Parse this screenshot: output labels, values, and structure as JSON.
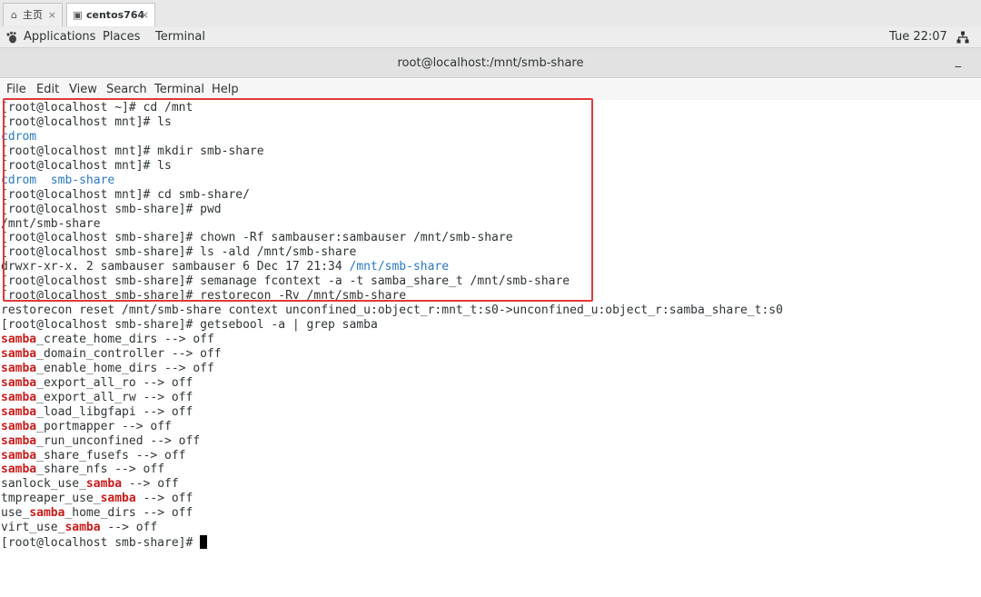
{
  "host_tabs": [
    {
      "label": "主页",
      "icon": "home-icon",
      "active": false
    },
    {
      "label": "centos764",
      "icon": "vm-icon",
      "active": true
    }
  ],
  "panel": {
    "applications": "Applications",
    "places": "Places",
    "terminal": "Terminal",
    "clock": "Tue 22:07"
  },
  "window": {
    "title": "root@localhost:/mnt/smb-share",
    "minimize_label": "_"
  },
  "menu": [
    "File",
    "Edit",
    "View",
    "Search",
    "Terminal",
    "Help"
  ],
  "colors": {
    "directory": "#2a78c4",
    "grep_match": "#cc1a1a",
    "highlight_box": "#e03a3a"
  },
  "terminal_lines": [
    [
      {
        "t": "[root@localhost ~]# cd /mnt"
      }
    ],
    [
      {
        "t": "[root@localhost mnt]# ls"
      }
    ],
    [
      {
        "t": "cdrom",
        "c": "dir"
      }
    ],
    [
      {
        "t": "[root@localhost mnt]# mkdir smb-share"
      }
    ],
    [
      {
        "t": "[root@localhost mnt]# ls"
      }
    ],
    [
      {
        "t": "cdrom",
        "c": "dir"
      },
      {
        "t": "  "
      },
      {
        "t": "smb-share",
        "c": "dir"
      }
    ],
    [
      {
        "t": "[root@localhost mnt]# cd smb-share/"
      }
    ],
    [
      {
        "t": "[root@localhost smb-share]# pwd"
      }
    ],
    [
      {
        "t": "/mnt/smb-share"
      }
    ],
    [
      {
        "t": "[root@localhost smb-share]# chown -Rf sambauser:sambauser /mnt/smb-share"
      }
    ],
    [
      {
        "t": "[root@localhost smb-share]# ls -ald /mnt/smb-share"
      }
    ],
    [
      {
        "t": "drwxr-xr-x. 2 sambauser sambauser 6 Dec 17 21:34 "
      },
      {
        "t": "/mnt/smb-share",
        "c": "dir"
      }
    ],
    [
      {
        "t": "[root@localhost smb-share]# semanage fcontext -a -t samba_share_t /mnt/smb-share"
      }
    ],
    [
      {
        "t": "[root@localhost smb-share]# restorecon -Rv /mnt/smb-share"
      }
    ],
    [
      {
        "t": "restorecon reset /mnt/smb-share context unconfined_u:object_r:mnt_t:s0->unconfined_u:object_r:samba_share_t:s0"
      }
    ],
    [
      {
        "t": "[root@localhost smb-share]# getsebool -a | grep samba"
      }
    ],
    [
      {
        "t": "samba",
        "c": "hl"
      },
      {
        "t": "_create_home_dirs --> off"
      }
    ],
    [
      {
        "t": "samba",
        "c": "hl"
      },
      {
        "t": "_domain_controller --> off"
      }
    ],
    [
      {
        "t": "samba",
        "c": "hl"
      },
      {
        "t": "_enable_home_dirs --> off"
      }
    ],
    [
      {
        "t": "samba",
        "c": "hl"
      },
      {
        "t": "_export_all_ro --> off"
      }
    ],
    [
      {
        "t": "samba",
        "c": "hl"
      },
      {
        "t": "_export_all_rw --> off"
      }
    ],
    [
      {
        "t": "samba",
        "c": "hl"
      },
      {
        "t": "_load_libgfapi --> off"
      }
    ],
    [
      {
        "t": "samba",
        "c": "hl"
      },
      {
        "t": "_portmapper --> off"
      }
    ],
    [
      {
        "t": "samba",
        "c": "hl"
      },
      {
        "t": "_run_unconfined --> off"
      }
    ],
    [
      {
        "t": "samba",
        "c": "hl"
      },
      {
        "t": "_share_fusefs --> off"
      }
    ],
    [
      {
        "t": "samba",
        "c": "hl"
      },
      {
        "t": "_share_nfs --> off"
      }
    ],
    [
      {
        "t": "sanlock_use_"
      },
      {
        "t": "samba",
        "c": "hl"
      },
      {
        "t": " --> off"
      }
    ],
    [
      {
        "t": "tmpreaper_use_"
      },
      {
        "t": "samba",
        "c": "hl"
      },
      {
        "t": " --> off"
      }
    ],
    [
      {
        "t": "use_"
      },
      {
        "t": "samba",
        "c": "hl"
      },
      {
        "t": "_home_dirs --> off"
      }
    ],
    [
      {
        "t": "virt_use_"
      },
      {
        "t": "samba",
        "c": "hl"
      },
      {
        "t": " --> off"
      }
    ],
    [
      {
        "t": "[root@localhost smb-share]# "
      },
      {
        "t": "",
        "c": "cursor"
      }
    ]
  ]
}
